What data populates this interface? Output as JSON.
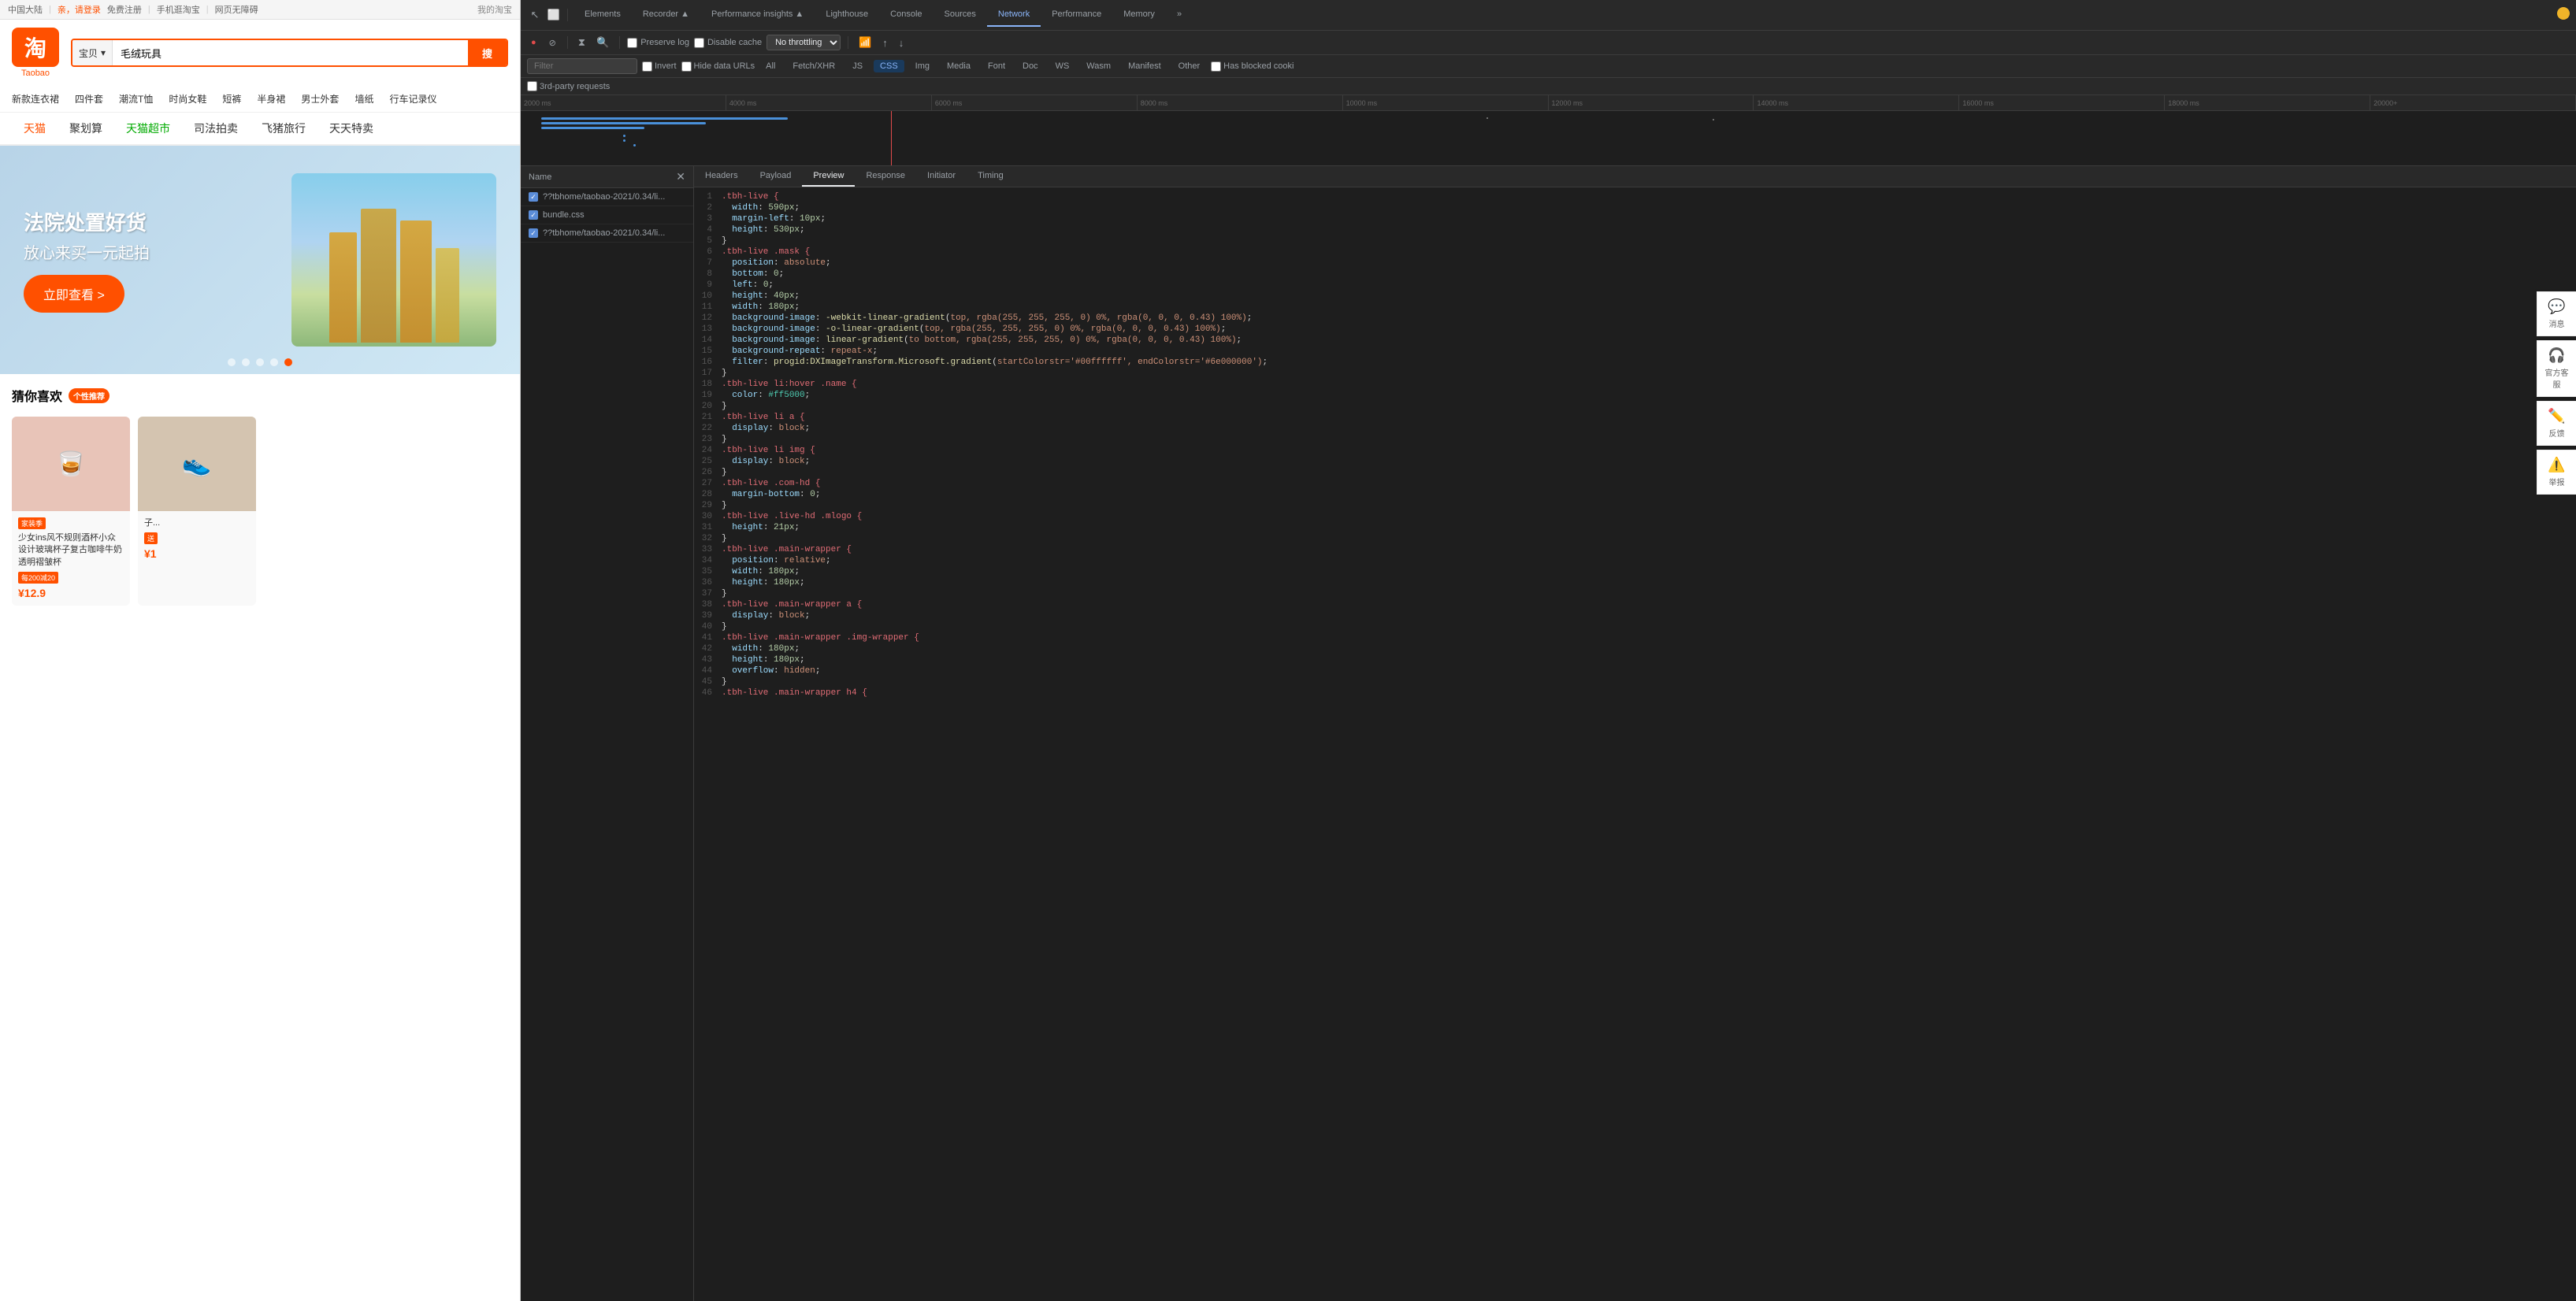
{
  "taobao": {
    "topbar": {
      "region": "中国大陆",
      "login_prompt": "亲，请登录",
      "free_register": "免费注册",
      "mobile": "手机逛淘宝",
      "no_barrier": "网页无障碍",
      "my_taobao": "我的淘宝"
    },
    "logo": {
      "char": "淘",
      "text": "Taobao"
    },
    "search": {
      "category": "宝贝",
      "query": "毛绒玩具",
      "button": "搜"
    },
    "nav_links": [
      "新款连衣裙",
      "四件套",
      "潮流T恤",
      "时尚女鞋",
      "短裤",
      "半身裙",
      "男士外套",
      "墙纸",
      "行车记录仪"
    ],
    "main_nav": [
      {
        "label": "天猫",
        "active": false,
        "color": "red"
      },
      {
        "label": "聚划算",
        "active": false,
        "color": "normal"
      },
      {
        "label": "天猫超市",
        "active": false,
        "color": "green"
      },
      {
        "label": "司法拍卖",
        "active": false,
        "color": "normal"
      },
      {
        "label": "飞猪旅行",
        "active": false,
        "color": "normal"
      },
      {
        "label": "天天特卖",
        "active": false,
        "color": "normal"
      }
    ],
    "banner": {
      "line1": "法院处置好货",
      "line2": "放心来买一元起拍",
      "button": "立即查看 >"
    },
    "sidebar": [
      {
        "icon": "💬",
        "label": "消息"
      },
      {
        "icon": "🎧",
        "label": "官方客服"
      },
      {
        "icon": "✏️",
        "label": "反馈"
      },
      {
        "icon": "⚠️",
        "label": "举报"
      }
    ],
    "section_title": "猜你喜欢",
    "recommend_badge": "个性推荐",
    "products": [
      {
        "tag": "家装季",
        "name": "少女ins风不规则酒杯小众设计玻璃杯子复古咖啡牛奶透明褶皱杯",
        "discount_tag": "每200减20",
        "price": "¥12.9",
        "img_color": "#e8c4b8"
      },
      {
        "tag": "",
        "name": "子...",
        "discount_tag": "送",
        "price": "¥1",
        "img_color": "#d4c4b0"
      }
    ]
  },
  "devtools": {
    "tabs": [
      {
        "label": "Elements",
        "active": false
      },
      {
        "label": "Recorder ▲",
        "active": false
      },
      {
        "label": "Performance insights ▲",
        "active": false
      },
      {
        "label": "Lighthouse",
        "active": false
      },
      {
        "label": "Console",
        "active": false
      },
      {
        "label": "Sources",
        "active": false
      },
      {
        "label": "Network",
        "active": true
      },
      {
        "label": "Performance",
        "active": false
      },
      {
        "label": "Memory",
        "active": false
      },
      {
        "label": "»",
        "active": false
      }
    ],
    "toolbar": {
      "record_label": "●",
      "stop_label": "⊘",
      "filter_icon": "⧖",
      "search_icon": "🔍",
      "preserve_log": "Preserve log",
      "disable_cache": "Disable cache",
      "throttling": "No throttling",
      "throttling_dropdown": "▼",
      "wifi_icon": "📶",
      "upload_icon": "↑",
      "download_icon": "↓"
    },
    "filter_bar": {
      "filter_placeholder": "Filter",
      "invert_label": "Invert",
      "hide_data_urls": "Hide data URLs",
      "all_label": "All",
      "fetch_xhr": "Fetch/XHR",
      "js": "JS",
      "css": "CSS",
      "img": "Img",
      "media": "Media",
      "font": "Font",
      "doc": "Doc",
      "ws": "WS",
      "wasm": "Wasm",
      "manifest": "Manifest",
      "other": "Other",
      "has_blocked": "Has blocked cooki",
      "third_party": "3rd-party requests"
    },
    "timeline": {
      "ticks": [
        "2000 ms",
        "4000 ms",
        "6000 ms",
        "8000 ms",
        "10000 ms",
        "12000 ms",
        "14000 ms",
        "16000 ms",
        "18000 ms",
        "20000+"
      ]
    },
    "file_list": {
      "header": "Name",
      "files": [
        {
          "name": "??tbhome/taobao-2021/0.34/li...",
          "checked": true
        },
        {
          "name": "bundle.css",
          "checked": true
        },
        {
          "name": "??tbhome/taobao-2021/0.34/li...",
          "checked": true
        }
      ]
    },
    "details_tabs": [
      "Headers",
      "Payload",
      "Preview",
      "Response",
      "Initiator",
      "Timing"
    ],
    "active_details_tab": "Preview",
    "css_preview": [
      {
        "num": 1,
        "content": [
          {
            "text": ".tbh-live {",
            "class": "css-selector"
          }
        ]
      },
      {
        "num": 2,
        "content": [
          {
            "text": "  width: ",
            "class": "css-prop-indent"
          },
          {
            "text": "590px",
            "class": "css-value-num"
          },
          {
            "text": ";",
            "class": "css-punctuation"
          }
        ]
      },
      {
        "num": 3,
        "content": [
          {
            "text": "  margin-left: ",
            "class": "css-prop-indent"
          },
          {
            "text": "10px",
            "class": "css-value-num"
          },
          {
            "text": ";",
            "class": "css-punctuation"
          }
        ]
      },
      {
        "num": 4,
        "content": [
          {
            "text": "  height: ",
            "class": "css-prop-indent"
          },
          {
            "text": "530px",
            "class": "css-value-num"
          },
          {
            "text": ";",
            "class": "css-punctuation"
          }
        ]
      },
      {
        "num": 5,
        "content": [
          {
            "text": "}",
            "class": "css-punctuation"
          }
        ]
      },
      {
        "num": 6,
        "content": [
          {
            "text": ".tbh-live .mask {",
            "class": "css-selector"
          }
        ]
      },
      {
        "num": 7,
        "content": [
          {
            "text": "  position: ",
            "class": "css-prop-indent"
          },
          {
            "text": "absolute",
            "class": "css-value"
          },
          {
            "text": ";",
            "class": "css-punctuation"
          }
        ]
      },
      {
        "num": 8,
        "content": [
          {
            "text": "  bottom: ",
            "class": "css-prop-indent"
          },
          {
            "text": "0",
            "class": "css-value-num"
          },
          {
            "text": ";",
            "class": "css-punctuation"
          }
        ]
      },
      {
        "num": 9,
        "content": [
          {
            "text": "  left: ",
            "class": "css-prop-indent"
          },
          {
            "text": "0",
            "class": "css-value-num"
          },
          {
            "text": ";",
            "class": "css-punctuation"
          }
        ]
      },
      {
        "num": 10,
        "content": [
          {
            "text": "  height: ",
            "class": "css-prop-indent"
          },
          {
            "text": "40px",
            "class": "css-value-num"
          },
          {
            "text": ";",
            "class": "css-punctuation"
          }
        ]
      },
      {
        "num": 11,
        "content": [
          {
            "text": "  width: ",
            "class": "css-prop-indent"
          },
          {
            "text": "180px",
            "class": "css-value-num"
          },
          {
            "text": ";",
            "class": "css-punctuation"
          }
        ]
      },
      {
        "num": 12,
        "content": [
          {
            "text": "  background-image: ",
            "class": "css-prop-indent"
          },
          {
            "text": "-webkit-linear-gradient(top, rgba(255, 255, 255, 0) 0%, rgba(0, 0, 0, 0.43) 100%)",
            "class": "css-value-func"
          },
          {
            "text": ";",
            "class": "css-punctuation"
          }
        ]
      },
      {
        "num": 13,
        "content": [
          {
            "text": "  background-image: ",
            "class": "css-prop-indent"
          },
          {
            "text": "-o-linear-gradient(top, rgba(255, 255, 255, 0) 0%, rgba(0, 0, 0, 0.43) 100%)",
            "class": "css-value-func"
          },
          {
            "text": ";",
            "class": "css-punctuation"
          }
        ]
      },
      {
        "num": 14,
        "content": [
          {
            "text": "  background-image: ",
            "class": "css-prop-indent"
          },
          {
            "text": "linear-gradient(to bottom, rgba(255, 255, 255, 0) 0%, rgba(0, 0, 0, 0.43) 100%)",
            "class": "css-value-func"
          },
          {
            "text": ";",
            "class": "css-punctuation"
          }
        ]
      },
      {
        "num": 15,
        "content": [
          {
            "text": "  background-repeat: ",
            "class": "css-prop-indent"
          },
          {
            "text": "repeat-x",
            "class": "css-value"
          },
          {
            "text": ";",
            "class": "css-punctuation"
          }
        ]
      },
      {
        "num": 16,
        "content": [
          {
            "text": "  filter: ",
            "class": "css-prop-indent"
          },
          {
            "text": "progid:DXImageTransform.Microsoft.gradient(startColorstr='#00ffffff', endColorstr='#6e000000')",
            "class": "css-value-func"
          },
          {
            "text": ";",
            "class": "css-punctuation"
          }
        ]
      },
      {
        "num": 17,
        "content": [
          {
            "text": "}",
            "class": "css-punctuation"
          }
        ]
      },
      {
        "num": 18,
        "content": [
          {
            "text": ".tbh-live li:hover .name {",
            "class": "css-selector"
          }
        ]
      },
      {
        "num": 19,
        "content": [
          {
            "text": "  color: ",
            "class": "css-prop-indent"
          },
          {
            "text": "#ff5000",
            "class": "css-hash"
          },
          {
            "text": ";",
            "class": "css-punctuation"
          }
        ]
      },
      {
        "num": 20,
        "content": [
          {
            "text": "}",
            "class": "css-punctuation"
          }
        ]
      },
      {
        "num": 21,
        "content": [
          {
            "text": ".tbh-live li a {",
            "class": "css-selector"
          }
        ]
      },
      {
        "num": 22,
        "content": [
          {
            "text": "  display: ",
            "class": "css-prop-indent"
          },
          {
            "text": "block",
            "class": "css-value"
          },
          {
            "text": ";",
            "class": "css-punctuation"
          }
        ]
      },
      {
        "num": 23,
        "content": [
          {
            "text": "}",
            "class": "css-punctuation"
          }
        ]
      },
      {
        "num": 24,
        "content": [
          {
            "text": ".tbh-live li img {",
            "class": "css-selector"
          }
        ]
      },
      {
        "num": 25,
        "content": [
          {
            "text": "  display: ",
            "class": "css-prop-indent"
          },
          {
            "text": "block",
            "class": "css-value"
          },
          {
            "text": ";",
            "class": "css-punctuation"
          }
        ]
      },
      {
        "num": 26,
        "content": [
          {
            "text": "}",
            "class": "css-punctuation"
          }
        ]
      },
      {
        "num": 27,
        "content": [
          {
            "text": ".tbh-live .com-hd {",
            "class": "css-selector"
          }
        ]
      },
      {
        "num": 28,
        "content": [
          {
            "text": "  margin-bottom: ",
            "class": "css-prop-indent"
          },
          {
            "text": "0",
            "class": "css-value-num"
          },
          {
            "text": ";",
            "class": "css-punctuation"
          }
        ]
      },
      {
        "num": 29,
        "content": [
          {
            "text": "}",
            "class": "css-punctuation"
          }
        ]
      },
      {
        "num": 30,
        "content": [
          {
            "text": ".tbh-live .live-hd .mlogo {",
            "class": "css-selector"
          }
        ]
      },
      {
        "num": 31,
        "content": [
          {
            "text": "  height: ",
            "class": "css-prop-indent"
          },
          {
            "text": "21px",
            "class": "css-value-num"
          },
          {
            "text": ";",
            "class": "css-punctuation"
          }
        ]
      },
      {
        "num": 32,
        "content": [
          {
            "text": "}",
            "class": "css-punctuation"
          }
        ]
      },
      {
        "num": 33,
        "content": [
          {
            "text": ".tbh-live .main-wrapper {",
            "class": "css-selector"
          }
        ]
      },
      {
        "num": 34,
        "content": [
          {
            "text": "  position: ",
            "class": "css-prop-indent"
          },
          {
            "text": "relative",
            "class": "css-value"
          },
          {
            "text": ";",
            "class": "css-punctuation"
          }
        ]
      },
      {
        "num": 35,
        "content": [
          {
            "text": "  width: ",
            "class": "css-prop-indent"
          },
          {
            "text": "180px",
            "class": "css-value-num"
          },
          {
            "text": ";",
            "class": "css-punctuation"
          }
        ]
      },
      {
        "num": 36,
        "content": [
          {
            "text": "  height: ",
            "class": "css-prop-indent"
          },
          {
            "text": "180px",
            "class": "css-value-num"
          },
          {
            "text": ";",
            "class": "css-punctuation"
          }
        ]
      },
      {
        "num": 37,
        "content": [
          {
            "text": "}",
            "class": "css-punctuation"
          }
        ]
      },
      {
        "num": 38,
        "content": [
          {
            "text": ".tbh-live .main-wrapper a {",
            "class": "css-selector"
          }
        ]
      },
      {
        "num": 39,
        "content": [
          {
            "text": "  display: ",
            "class": "css-prop-indent"
          },
          {
            "text": "block",
            "class": "css-value"
          },
          {
            "text": ";",
            "class": "css-punctuation"
          }
        ]
      },
      {
        "num": 40,
        "content": [
          {
            "text": "}",
            "class": "css-punctuation"
          }
        ]
      },
      {
        "num": 41,
        "content": [
          {
            "text": ".tbh-live .main-wrapper .img-wrapper {",
            "class": "css-selector"
          }
        ]
      },
      {
        "num": 42,
        "content": [
          {
            "text": "  width: ",
            "class": "css-prop-indent"
          },
          {
            "text": "180px",
            "class": "css-value-num"
          },
          {
            "text": ";",
            "class": "css-punctuation"
          }
        ]
      },
      {
        "num": 43,
        "content": [
          {
            "text": "  height: ",
            "class": "css-prop-indent"
          },
          {
            "text": "180px",
            "class": "css-value-num"
          },
          {
            "text": ";",
            "class": "css-punctuation"
          }
        ]
      },
      {
        "num": 44,
        "content": [
          {
            "text": "  overflow: ",
            "class": "css-prop-indent"
          },
          {
            "text": "hidden",
            "class": "css-value"
          },
          {
            "text": ";",
            "class": "css-punctuation"
          }
        ]
      },
      {
        "num": 45,
        "content": [
          {
            "text": "}",
            "class": "css-punctuation"
          }
        ]
      },
      {
        "num": 46,
        "content": [
          {
            "text": ".tbh-live .main-wrapper h4 {",
            "class": "css-selector"
          }
        ]
      }
    ]
  }
}
